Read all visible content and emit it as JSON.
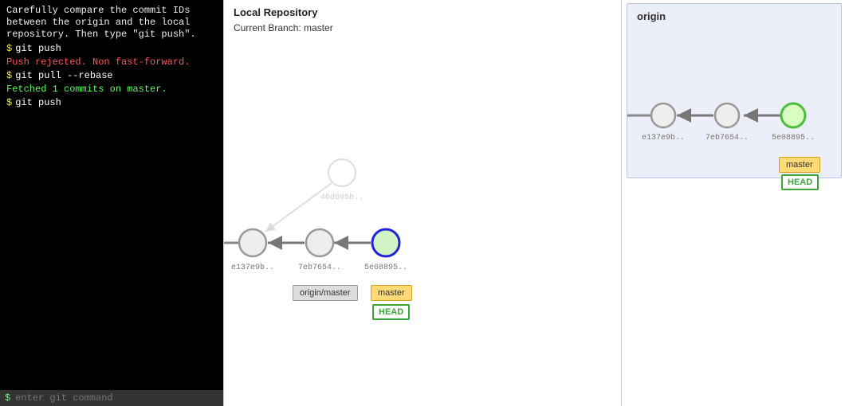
{
  "terminal": {
    "instruction": "Carefully compare the commit IDs between the origin and the local repository. Then type \"git push\".",
    "lines": [
      {
        "kind": "cmd",
        "text": "git push"
      },
      {
        "kind": "err",
        "text": "Push rejected. Non fast-forward."
      },
      {
        "kind": "cmd",
        "text": "git pull --rebase"
      },
      {
        "kind": "ok",
        "text": "Fetched 1 commits on master."
      },
      {
        "kind": "cmd",
        "text": "git push"
      }
    ],
    "input_placeholder": "enter git command",
    "prompt": "$"
  },
  "local": {
    "title": "Local Repository",
    "subtitle": "Current Branch: master",
    "commits": [
      {
        "id": "e137e9b..",
        "state": "normal"
      },
      {
        "id": "7eb7654..",
        "state": "normal"
      },
      {
        "id": "5e08895..",
        "state": "head"
      }
    ],
    "rebased_commit": {
      "id": "46d095b..",
      "state": "faded"
    },
    "refs": {
      "origin_master": "origin/master",
      "master": "master",
      "head": "HEAD"
    }
  },
  "origin": {
    "title": "origin",
    "commits": [
      {
        "id": "e137e9b..",
        "state": "normal"
      },
      {
        "id": "7eb7654..",
        "state": "normal"
      },
      {
        "id": "5e08895..",
        "state": "head"
      }
    ],
    "refs": {
      "master": "master",
      "head": "HEAD"
    }
  }
}
